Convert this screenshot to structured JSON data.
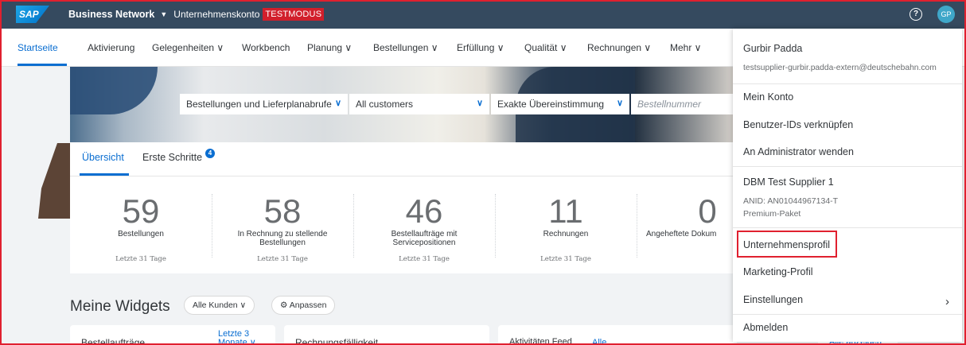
{
  "shell": {
    "logo": "SAP",
    "app_title": "Business Network",
    "company": "Unternehmenskonto",
    "mode_badge": "TESTMODUS",
    "help_icon": "?",
    "avatar": "GP"
  },
  "nav": {
    "items": [
      {
        "label": "Startseite"
      },
      {
        "label": "Aktivierung"
      },
      {
        "label": "Gelegenheiten ∨"
      },
      {
        "label": "Workbench"
      },
      {
        "label": "Planung ∨"
      },
      {
        "label": "Bestellungen ∨"
      },
      {
        "label": "Erfüllung ∨"
      },
      {
        "label": "Qualität ∨"
      },
      {
        "label": "Rechnungen ∨"
      },
      {
        "label": "Mehr ∨"
      }
    ]
  },
  "search": {
    "doc_type": "Bestellungen und Lieferplanabrufe",
    "customers": "All customers",
    "match": "Exakte Übereinstimmung",
    "placeholder": "Bestellnummer"
  },
  "overview": {
    "tab_overview": "Übersicht",
    "tab_first_steps": "Erste Schritte",
    "first_steps_badge": "4",
    "kpis": [
      {
        "value": "59",
        "label": "Bestellungen",
        "period": "Letzte 31 Tage"
      },
      {
        "value": "58",
        "label": "In Rechnung zu stellende Bestellungen",
        "period": "Letzte 31 Tage"
      },
      {
        "value": "46",
        "label": "Bestellaufträge mit Servicepositionen",
        "period": "Letzte 31 Tage"
      },
      {
        "value": "11",
        "label": "Rechnungen",
        "period": "Letzte 31 Tage"
      },
      {
        "value": "0",
        "label": "Angeheftete Dokum",
        "period": ""
      }
    ]
  },
  "widgets": {
    "title": "Meine Widgets",
    "filter": "Alle Kunden ∨",
    "customize": "⚙ Anpassen",
    "cards": [
      {
        "title": "Bestellaufträge",
        "link": "Letzte 3 Monate ∨"
      },
      {
        "title": "Rechnungsfälligkeit"
      },
      {
        "title": "Aktivitäten Feed",
        "link": "Alle"
      },
      {
        "link": "Alle anzeigen"
      }
    ]
  },
  "menu": {
    "user_name": "Gurbir Padda",
    "user_email": "testsupplier-gurbir.padda-extern@deutschebahn.com",
    "my_account": "Mein Konto",
    "link_ids": "Benutzer-IDs verknüpfen",
    "contact_admin": "An Administrator wenden",
    "company_name": "DBM Test Supplier 1",
    "anid": "ANID: AN01044967134-T",
    "package": "Premium-Paket",
    "company_profile": "Unternehmensprofil",
    "marketing_profile": "Marketing-Profil",
    "settings": "Einstellungen",
    "logout": "Abmelden",
    "arrow": "›"
  },
  "colors": {
    "shell": "#354a5f",
    "accent": "#0a6ed1",
    "highlight": "#e0202f",
    "testmodus": "#d11f2b"
  }
}
